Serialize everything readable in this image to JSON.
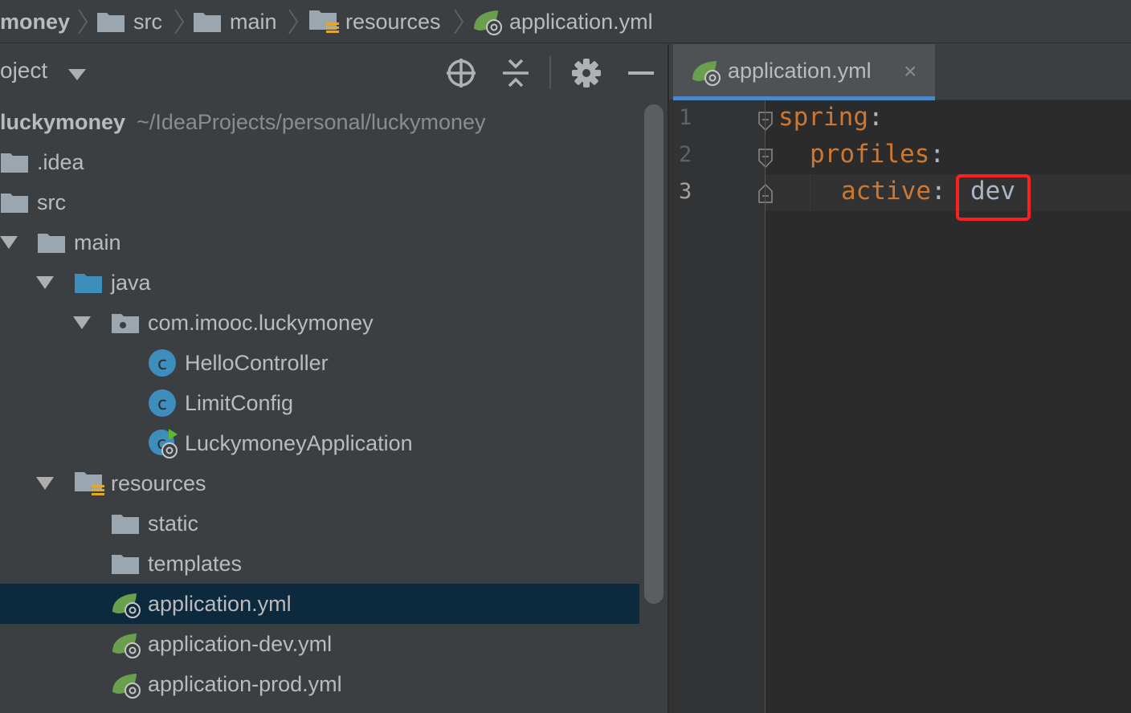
{
  "breadcrumb": {
    "items": [
      {
        "label": "money",
        "icon": "none"
      },
      {
        "label": "src",
        "icon": "folder-icon"
      },
      {
        "label": "main",
        "icon": "folder-icon"
      },
      {
        "label": "resources",
        "icon": "resources-folder-icon"
      },
      {
        "label": "application.yml",
        "icon": "spring-config-icon"
      }
    ]
  },
  "project_panel": {
    "title": "oject",
    "toolbar": [
      "locate-icon",
      "collapse-all-icon",
      "gear-icon",
      "hide-icon"
    ]
  },
  "tree": {
    "root": {
      "label": "luckymoney",
      "path": "~/IdeaProjects/personal/luckymoney"
    },
    "items": [
      {
        "label": ".idea",
        "icon": "folder-icon"
      },
      {
        "label": "src",
        "icon": "folder-icon"
      },
      {
        "label": "main",
        "icon": "folder-icon"
      },
      {
        "label": "java",
        "icon": "source-folder-icon"
      },
      {
        "label": "com.imooc.luckymoney",
        "icon": "package-icon"
      },
      {
        "label": "HelloController",
        "icon": "class-icon"
      },
      {
        "label": "LimitConfig",
        "icon": "class-icon"
      },
      {
        "label": "LuckymoneyApplication",
        "icon": "spring-boot-class-icon"
      },
      {
        "label": "resources",
        "icon": "resources-folder-icon"
      },
      {
        "label": "static",
        "icon": "folder-icon"
      },
      {
        "label": "templates",
        "icon": "folder-icon"
      },
      {
        "label": "application.yml",
        "icon": "spring-config-icon",
        "selected": true
      },
      {
        "label": "application-dev.yml",
        "icon": "spring-config-icon"
      },
      {
        "label": "application-prod.yml",
        "icon": "spring-config-icon"
      }
    ]
  },
  "editor": {
    "tab_label": "application.yml",
    "tab_close": "×",
    "line_numbers": [
      "1",
      "2",
      "3"
    ],
    "code": {
      "line1": {
        "key": "spring",
        "colon": ":"
      },
      "line2": {
        "key": "profiles",
        "colon": ":"
      },
      "line3": {
        "key": "active",
        "colon": ":",
        "value": "dev"
      }
    }
  },
  "colors": {
    "background": "#3c3f41",
    "editor_bg": "#2b2b2b",
    "selection": "#0d293e",
    "yaml_key": "#cc7832",
    "highlight_box": "#ff1f1f",
    "tab_underline": "#4a88c7"
  }
}
